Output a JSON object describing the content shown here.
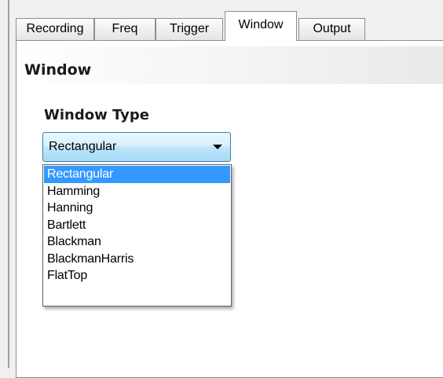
{
  "tabs": [
    {
      "label": "Recording"
    },
    {
      "label": "Freq"
    },
    {
      "label": "Trigger"
    },
    {
      "label": "Window"
    },
    {
      "label": "Output"
    }
  ],
  "active_tab": "Window",
  "panel": {
    "title": "Window",
    "window_type_label": "Window Type"
  },
  "window_type_select": {
    "selected_value": "Rectangular",
    "options": [
      "Rectangular",
      "Hamming",
      "Hanning",
      "Bartlett",
      "Blackman",
      "BlackmanHarris",
      "FlatTop"
    ],
    "highlighted_option": "Rectangular"
  },
  "colors": {
    "selection_highlight": "#3399ff",
    "combo_border": "#3c7fb1"
  }
}
